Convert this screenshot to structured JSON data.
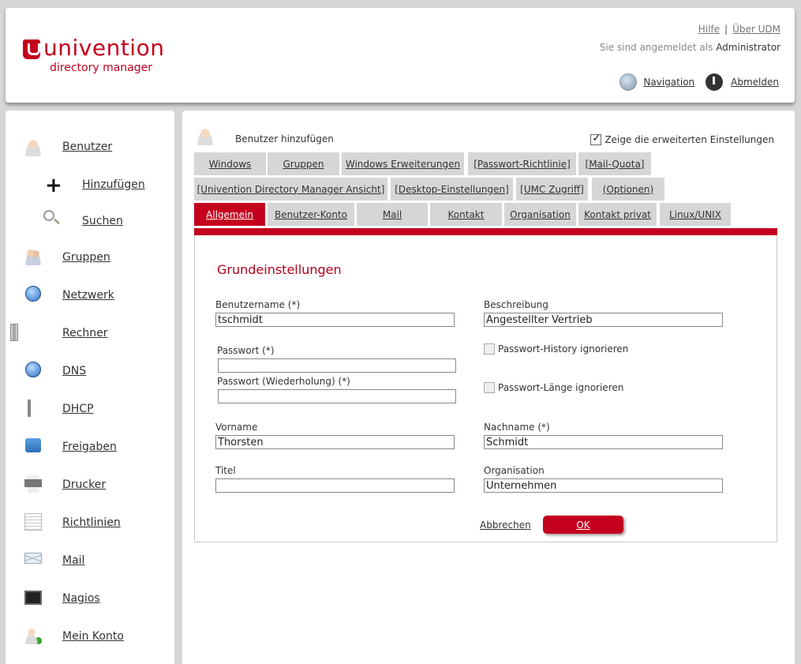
{
  "header": {
    "logo_text": "univention",
    "logo_sub": "directory manager",
    "help_link": "Hilfe",
    "separator": "|",
    "about_link": "Über UDM",
    "login_prefix": "Sie sind angemeldet als ",
    "login_user": "Administrator",
    "navigation_link": "Navigation",
    "logout_link": "Abmelden"
  },
  "sidebar": {
    "items": [
      {
        "label": "Benutzer",
        "icon": "user-icon"
      },
      {
        "label": "Hinzufügen",
        "icon": "plus-icon"
      },
      {
        "label": "Suchen",
        "icon": "search-icon"
      },
      {
        "label": "Gruppen",
        "icon": "group-icon"
      },
      {
        "label": "Netzwerk",
        "icon": "network-globe-icon"
      },
      {
        "label": "Rechner",
        "icon": "computer-tower-icon"
      },
      {
        "label": "DNS",
        "icon": "dns-globe-icon"
      },
      {
        "label": "DHCP",
        "icon": "dhcp-icon"
      },
      {
        "label": "Freigaben",
        "icon": "share-icon"
      },
      {
        "label": "Drucker",
        "icon": "printer-icon"
      },
      {
        "label": "Richtlinien",
        "icon": "policy-icon"
      },
      {
        "label": "Mail",
        "icon": "mail-icon"
      },
      {
        "label": "Nagios",
        "icon": "nagios-icon"
      },
      {
        "label": "Mein Konto",
        "icon": "account-icon"
      }
    ]
  },
  "main": {
    "title": "Benutzer hinzufügen",
    "advanced_label": "Zeige die erweiterten Einstellungen",
    "tabs_row1": [
      "Windows",
      "Gruppen",
      "Windows Erweiterungen",
      "[Passwort-Richtlinie]",
      "[Mail-Quota]"
    ],
    "tabs_row2": [
      "[Univention Directory Manager Ansicht]",
      "[Desktop-Einstellungen]",
      "[UMC Zugriff]",
      "(Optionen)"
    ],
    "tabs_row3": [
      "Allgemein",
      "Benutzer-Konto",
      "Mail",
      "Kontakt",
      "Organisation",
      "Kontakt privat",
      "Linux/UNIX"
    ],
    "section_title": "Grundeinstellungen",
    "fields": {
      "username_label": "Benutzername (*)",
      "username_value": "tschmidt",
      "description_label": "Beschreibung",
      "description_value": "Angestellter Vertrieb",
      "password_label": "Passwort (*)",
      "password_value": "",
      "password_repeat_label": "Passwort (Wiederholung) (*)",
      "password_repeat_value": "",
      "history_label": "Passwort-History ignorieren",
      "length_label": "Passwort-Länge ignorieren",
      "firstname_label": "Vorname",
      "firstname_value": "Thorsten",
      "lastname_label": "Nachname (*)",
      "lastname_value": "Schmidt",
      "title_label": "Titel",
      "title_value": "",
      "organisation_label": "Organisation",
      "organisation_value": "Unternehmen"
    },
    "cancel_label": "Abbrechen",
    "ok_label": "OK"
  },
  "colors": {
    "brand": "#c4001e",
    "tab_inactive": "#d6d6d6"
  }
}
